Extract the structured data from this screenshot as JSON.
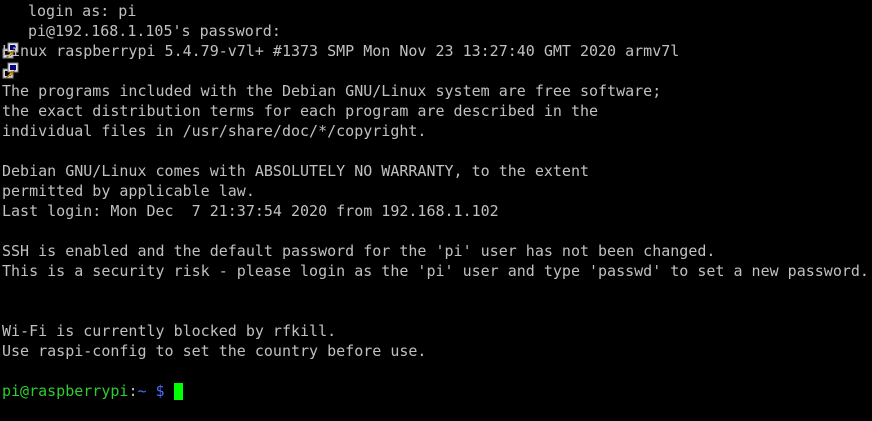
{
  "terminal": {
    "background": "#000000",
    "foreground": "#c0c0c0",
    "prompt_user_color": "#2ecc2e",
    "prompt_path_color": "#4a6cff",
    "cursor_color": "#00ff00",
    "login_line": "login as: pi",
    "password_line": "pi@192.168.1.105's password:",
    "kernel_line": "Linux raspberrypi 5.4.79-v7l+ #1373 SMP Mon Nov 23 13:27:40 GMT 2020 armv7l",
    "motd_1": "The programs included with the Debian GNU/Linux system are free software;",
    "motd_2": "the exact distribution terms for each program are described in the",
    "motd_3": "individual files in /usr/share/doc/*/copyright.",
    "warranty_1": "Debian GNU/Linux comes with ABSOLUTELY NO WARRANTY, to the extent",
    "warranty_2": "permitted by applicable law.",
    "last_login": "Last login: Mon Dec  7 21:37:54 2020 from 192.168.1.102",
    "ssh_warning_1": "SSH is enabled and the default password for the 'pi' user has not been changed.",
    "ssh_warning_2": "This is a security risk - please login as the 'pi' user and type 'passwd' to set a new password.",
    "wifi_1": "Wi-Fi is currently blocked by rfkill.",
    "wifi_2": "Use raspi-config to set the country before use.",
    "prompt_user": "pi@raspberrypi",
    "prompt_sep": ":",
    "prompt_path": "~",
    "prompt_symbol": " $",
    "icon": "putty-icon"
  }
}
